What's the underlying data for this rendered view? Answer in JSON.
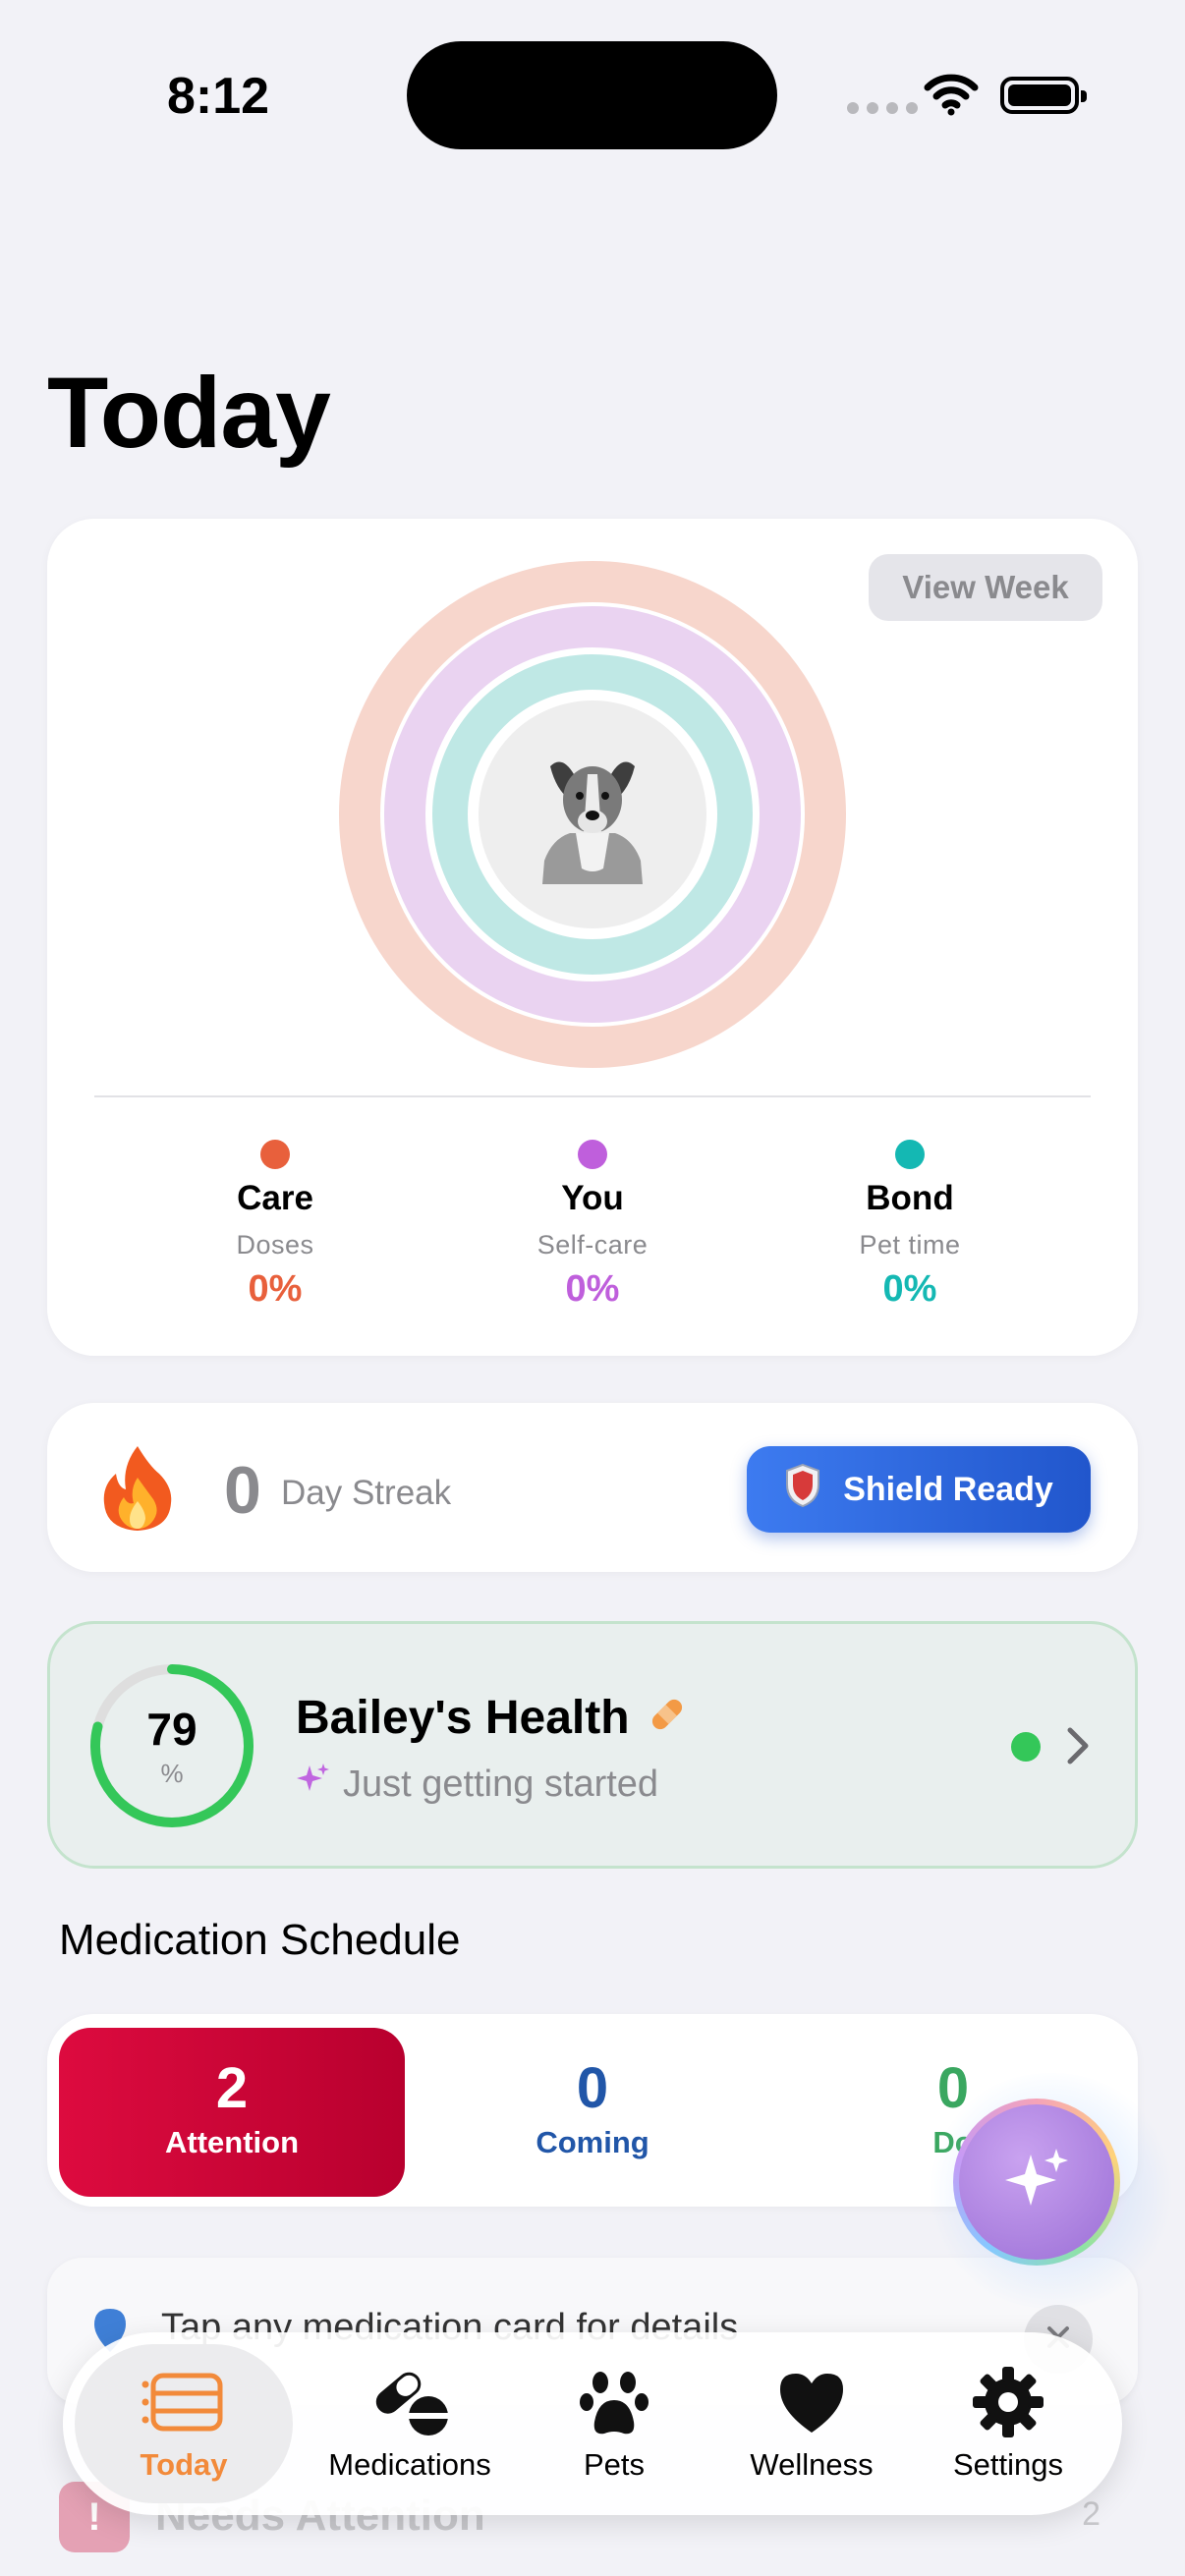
{
  "status_bar": {
    "time": "8:12"
  },
  "page_title": "Today",
  "rings_card": {
    "view_week_label": "View Week",
    "metrics": [
      {
        "label": "Care",
        "sub": "Doses",
        "value": "0%",
        "color": "#e8603c"
      },
      {
        "label": "You",
        "sub": "Self-care",
        "value": "0%",
        "color": "#bf5fdc"
      },
      {
        "label": "Bond",
        "sub": "Pet time",
        "value": "0%",
        "color": "#14b8b3"
      }
    ],
    "ring_progress": {
      "care": 0,
      "you": 0,
      "bond": 0
    }
  },
  "streak": {
    "count": "0",
    "label": "Day Streak",
    "shield_label": "Shield Ready"
  },
  "health": {
    "score": "79",
    "score_unit": "%",
    "score_fraction": 0.79,
    "title": "Bailey's Health",
    "subtitle": "Just getting started",
    "status_color": "#34c759"
  },
  "medication_schedule": {
    "title": "Medication Schedule",
    "counts": [
      {
        "value": "2",
        "label": "Attention",
        "color": "#dd0b3f"
      },
      {
        "value": "0",
        "label": "Coming",
        "color": "#2156a8"
      },
      {
        "value": "0",
        "label": "Do",
        "color": "#3aa760"
      }
    ],
    "hint": "Tap any medication card for details",
    "needs_attention": {
      "label": "Needs Attention",
      "count": "2",
      "badge": "!"
    }
  },
  "tab_bar": {
    "tabs": [
      {
        "label": "Today",
        "icon": "calendar-list-icon",
        "active": true
      },
      {
        "label": "Medications",
        "icon": "pills-icon",
        "active": false
      },
      {
        "label": "Pets",
        "icon": "paw-icon",
        "active": false
      },
      {
        "label": "Wellness",
        "icon": "heart-icon",
        "active": false
      },
      {
        "label": "Settings",
        "icon": "gear-icon",
        "active": false
      }
    ],
    "accent": "#f28a3a"
  },
  "fab": {
    "icon": "sparkles-icon"
  }
}
